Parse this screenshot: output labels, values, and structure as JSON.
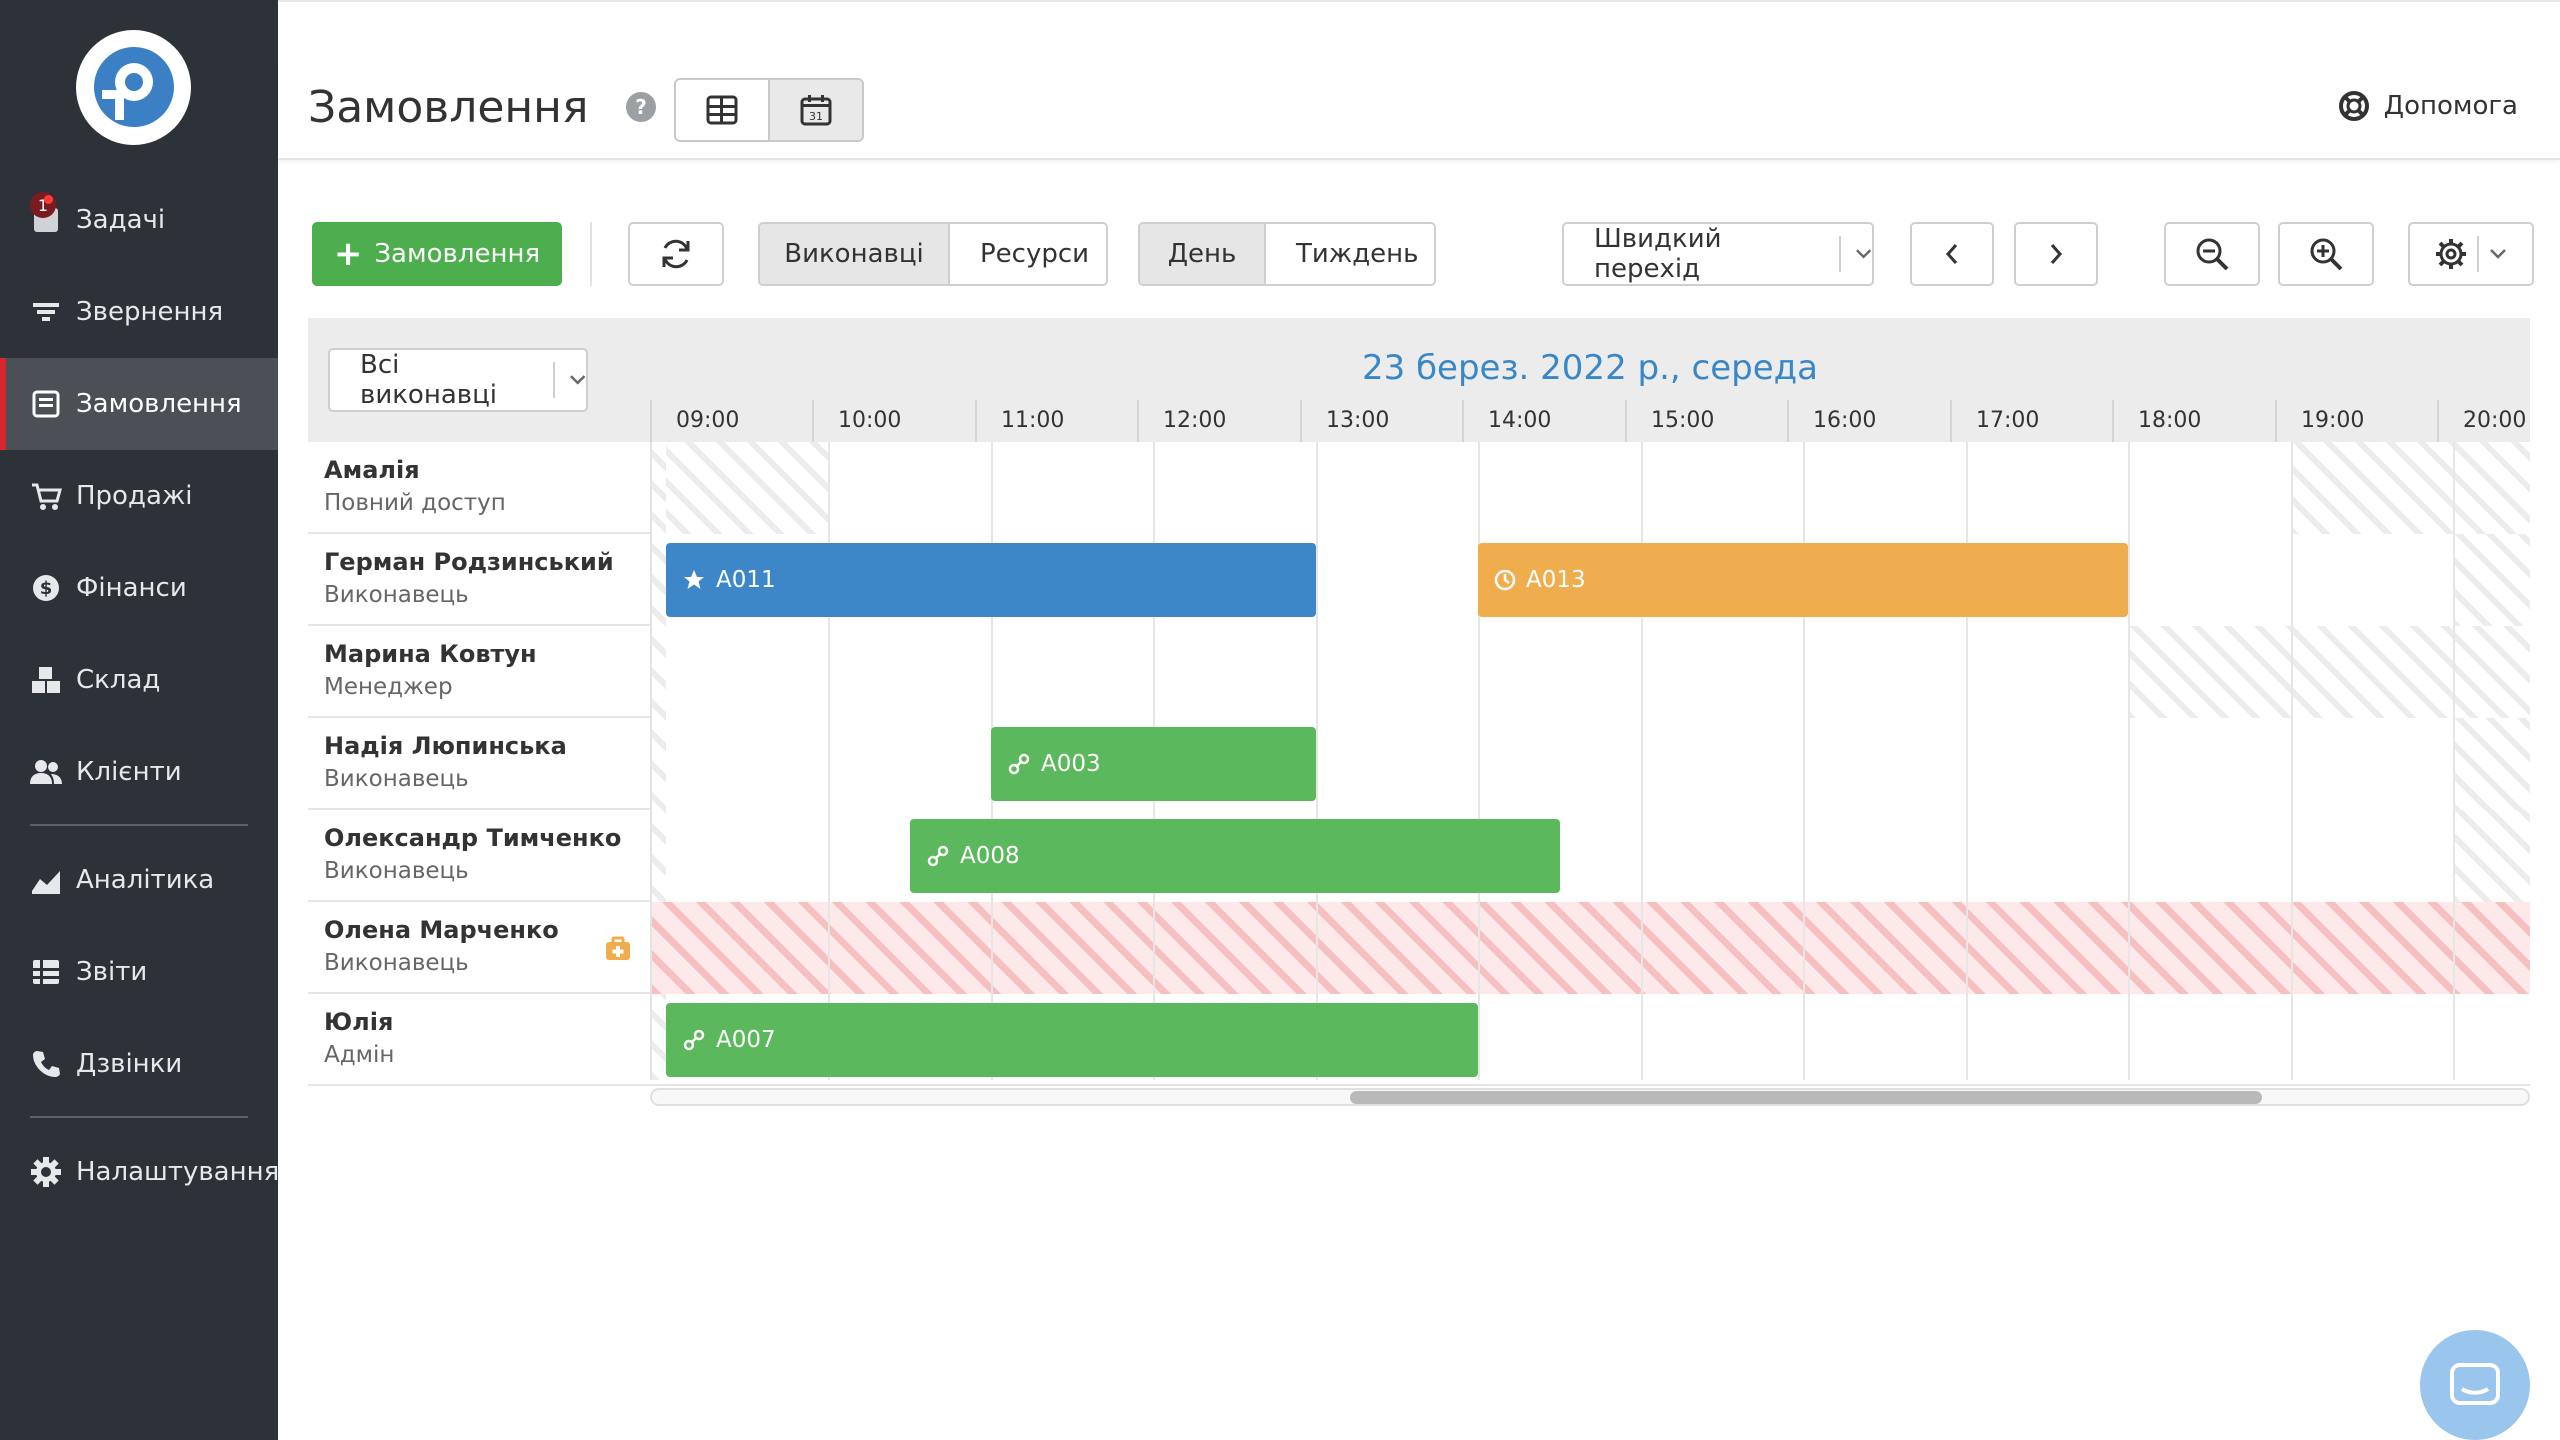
{
  "sidebar": {
    "badge": "1",
    "items": [
      {
        "label": "Задачі",
        "icon": "tasks-icon"
      },
      {
        "label": "Звернення",
        "icon": "filter-icon"
      },
      {
        "label": "Замовлення",
        "icon": "orders-icon",
        "active": true
      },
      {
        "label": "Продажі",
        "icon": "cart-icon"
      },
      {
        "label": "Фінанси",
        "icon": "dollar-icon"
      },
      {
        "label": "Склад",
        "icon": "warehouse-icon"
      },
      {
        "label": "Клієнти",
        "icon": "users-icon"
      },
      {
        "label": "Аналітика",
        "icon": "chart-icon"
      },
      {
        "label": "Звіти",
        "icon": "reports-icon"
      },
      {
        "label": "Дзвінки",
        "icon": "phone-icon"
      },
      {
        "label": "Налаштування",
        "icon": "gear-icon"
      }
    ]
  },
  "header": {
    "title": "Замовлення",
    "help_label": "Допомога"
  },
  "toolbar": {
    "add_order": "Замовлення",
    "group_by": [
      "Виконавці",
      "Ресурси"
    ],
    "period": [
      "День",
      "Тиждень"
    ],
    "quick_jump": "Швидкий перехід"
  },
  "scheduler": {
    "executor_filter": "Всі виконавці",
    "date_title": "23 берез. 2022 р., середа",
    "hours": [
      "09:00",
      "10:00",
      "11:00",
      "12:00",
      "13:00",
      "14:00",
      "15:00",
      "16:00",
      "17:00",
      "18:00",
      "19:00",
      "20:00"
    ],
    "resources": [
      {
        "name": "Амалія",
        "role": "Повний доступ"
      },
      {
        "name": "Герман Родзинський",
        "role": "Виконавець"
      },
      {
        "name": "Марина Ковтун",
        "role": "Менеджер"
      },
      {
        "name": "Надія Люпинська",
        "role": "Виконавець"
      },
      {
        "name": "Олександр Тимченко",
        "role": "Виконавець"
      },
      {
        "name": "Олена Марченко",
        "role": "Виконавець"
      },
      {
        "name": "Юлія",
        "role": "Адмін"
      }
    ],
    "events": [
      {
        "id": "A011",
        "icon": "star-icon",
        "color": "#3d87c9"
      },
      {
        "id": "A013",
        "icon": "clock-icon",
        "color": "#f0ad4e"
      },
      {
        "id": "A003",
        "icon": "link-icon",
        "color": "#5cb85c"
      },
      {
        "id": "A008",
        "icon": "link-icon",
        "color": "#5cb85c"
      },
      {
        "id": "A007",
        "icon": "link-icon",
        "color": "#5cb85c"
      }
    ]
  },
  "colors": {
    "sidebar_bg": "#2c3237",
    "active_marker": "#d8262e",
    "primary_green": "#4cae4c",
    "date_blue": "#3a87c8"
  }
}
